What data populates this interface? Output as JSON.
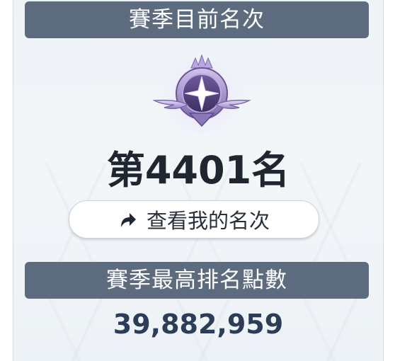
{
  "season_rank": {
    "header": "賽季目前名次",
    "badge_icon": "season-rank-emblem",
    "rank_label": "第4401名",
    "view_button_label": "查看我的名次",
    "view_button_icon": "share-arrow-icon"
  },
  "season_points": {
    "header": "賽季最高排名點數",
    "value": "39,882,959"
  },
  "colors": {
    "header_bg": "#5c6b7d",
    "rank_text": "#202630",
    "points_text": "#2b3d57",
    "badge_purple": "#8a78b8"
  }
}
